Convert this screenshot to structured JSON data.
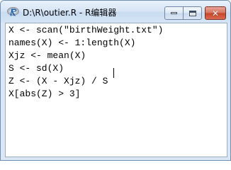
{
  "window": {
    "title": "D:\\R\\outier.R - R编辑器",
    "app_icon": "r-logo-icon",
    "controls": {
      "minimize_icon": "minimize-icon",
      "maximize_icon": "maximize-icon",
      "close_icon": "close-icon",
      "close_glyph": "✕"
    },
    "accent_close": "#c4442a"
  },
  "editor": {
    "lines": [
      "X <- scan(\"birthWeight.txt\")",
      "names(X) <- 1:length(X)",
      "Xjz <- mean(X)",
      "S <- sd(X)",
      "Z <- (X - Xjz) / S",
      "X[abs(Z) > 3]"
    ]
  }
}
